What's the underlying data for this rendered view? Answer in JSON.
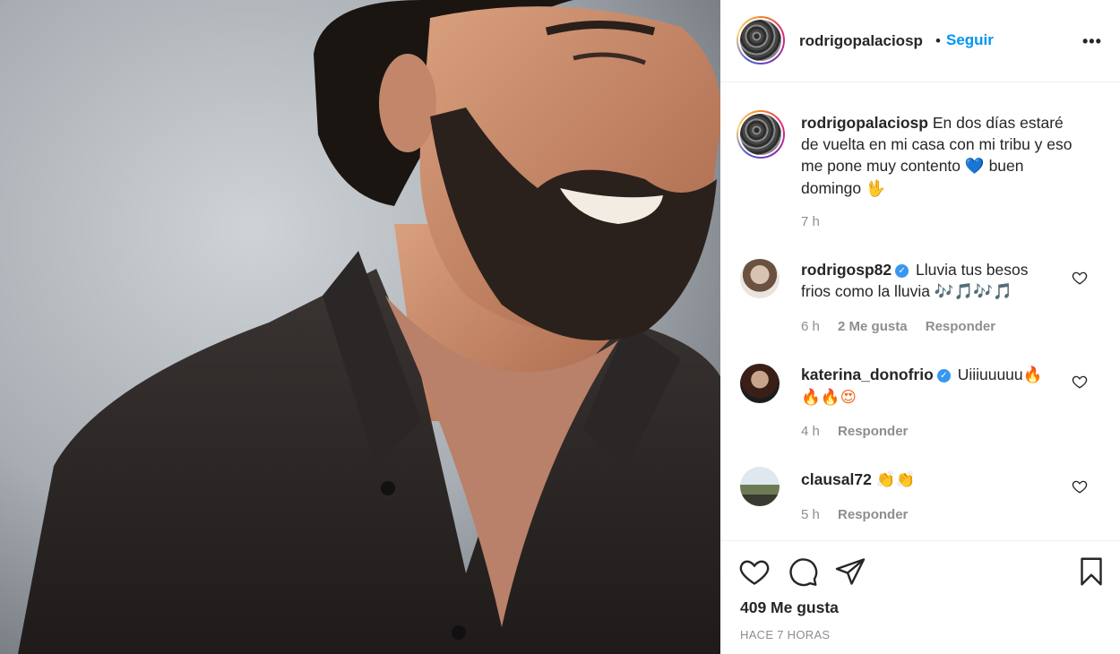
{
  "header": {
    "username": "rodrigopalaciosp",
    "separator": "•",
    "follow_label": "Seguir",
    "more_label": "•••"
  },
  "caption": {
    "username": "rodrigopalaciosp",
    "text_1": "En dos días estaré de vuelta en mi casa con mi tribu y eso me pone muy contento",
    "emoji_heart": "💙",
    "text_2": "buen domingo",
    "emoji_hand": "🖖",
    "time": "7 h"
  },
  "comments": [
    {
      "username": "rodrigosp82",
      "verified": true,
      "verified_mark": "✓",
      "text": "Lluvia tus besos frios como la lluvia",
      "emojis": "🎶🎵🎶🎵",
      "time": "6 h",
      "likes": "2 Me gusta",
      "reply": "Responder"
    },
    {
      "username": "katerina_donofrio",
      "verified": true,
      "verified_mark": "✓",
      "text": "Uiiiuuuuu",
      "emojis": "🔥🔥🔥😍",
      "time": "4 h",
      "reply": "Responder"
    },
    {
      "username": "clausal72",
      "verified": false,
      "text": "",
      "emojis": "👏👏",
      "time": "5 h",
      "reply": "Responder"
    }
  ],
  "footer": {
    "likes": "409 Me gusta",
    "posted": "HACE 7 HORAS"
  },
  "icons": {
    "like": "heart-icon",
    "comment": "comment-icon",
    "share": "paper-plane-icon",
    "save": "bookmark-icon",
    "more": "more-dots-icon"
  },
  "colors": {
    "follow": "#0095f6",
    "verified": "#3897f0",
    "muted": "#8e8e8e",
    "text": "#262626"
  }
}
